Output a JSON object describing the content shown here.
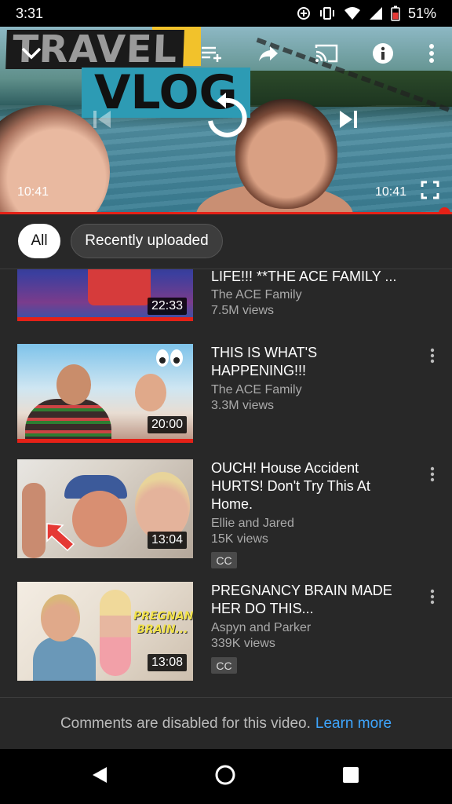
{
  "status_bar": {
    "time": "3:31",
    "battery": "51%"
  },
  "player": {
    "overlay_text_1": "TRAVEL",
    "overlay_text_2": "VLOG",
    "current_time": "10:41",
    "duration": "10:41",
    "progress_fraction": 1.0
  },
  "chips": [
    {
      "label": "All",
      "selected": true
    },
    {
      "label": "Recently uploaded",
      "selected": false
    }
  ],
  "videos": [
    {
      "title": "LIFE!!! **THE ACE FAMILY ...",
      "channel": "The ACE Family",
      "views": "7.5M views",
      "duration": "22:33",
      "watched": true
    },
    {
      "title": "THIS IS WHAT'S HAPPENING!!!",
      "channel": "The ACE Family",
      "views": "3.3M views",
      "duration": "20:00",
      "watched": true
    },
    {
      "title": "OUCH! House Accident HURTS! Don't Try This At Home.",
      "channel": "Ellie and Jared",
      "views": "15K views",
      "duration": "13:04",
      "badge": "CC"
    },
    {
      "title": "PREGNANCY BRAIN MADE HER DO THIS...",
      "channel": "Aspyn and Parker",
      "views": "339K views",
      "duration": "13:08",
      "badge": "CC",
      "thumb_text": "PREGNANCY BRAIN..."
    }
  ],
  "footer": {
    "message": "Comments are disabled for this video.",
    "link": "Learn more"
  },
  "colors": {
    "accent": "#e52117",
    "background": "#282828",
    "link": "#3ea6ff"
  }
}
